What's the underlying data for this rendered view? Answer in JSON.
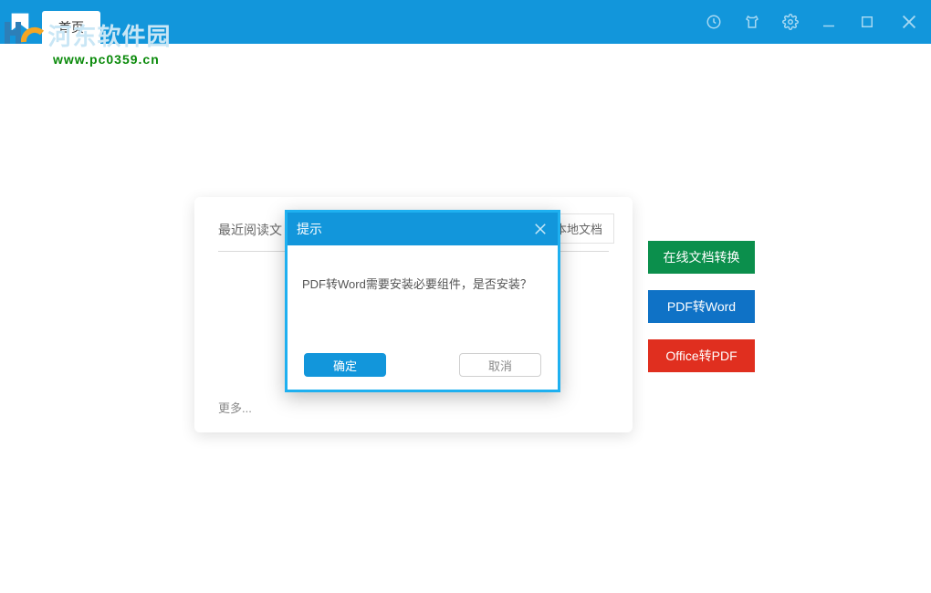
{
  "titlebar": {
    "tab_home": "首页"
  },
  "watermark": {
    "brand": "河东软件园",
    "url": "www.pc0359.cn"
  },
  "card": {
    "recent_label": "最近阅读文",
    "local_tab": "本地文档",
    "more": "更多..."
  },
  "side": {
    "convert_online": "在线文档转换",
    "pdf_to_word": "PDF转Word",
    "office_to_pdf": "Office转PDF"
  },
  "dialog": {
    "title": "提示",
    "message": "PDF转Word需要安装必要组件，是否安装？",
    "ok": "确定",
    "cancel": "取消"
  },
  "colors": {
    "primary_blue": "#1296db",
    "green": "#0b8f4c",
    "action_blue": "#0f72c6",
    "red": "#e02f1f"
  }
}
